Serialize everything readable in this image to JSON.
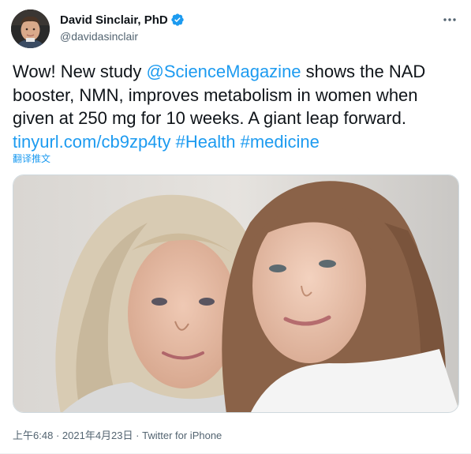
{
  "author": {
    "display_name": "David Sinclair, PhD",
    "handle": "@davidasinclair",
    "verified_icon": "verified-badge-icon",
    "verified_color": "#1d9bf0"
  },
  "tweet": {
    "lines": [
      [
        {
          "text": "Wow! New study ",
          "type": "text"
        },
        {
          "text": "@ScienceMagazine",
          "type": "mention"
        },
        {
          "text": " shows the NAD",
          "type": "text"
        }
      ],
      [
        {
          "text": "booster, NMN, improves metabolism in women when",
          "type": "text"
        }
      ],
      [
        {
          "text": "given at 250 mg for 10 weeks. A giant leap forward.",
          "type": "text"
        }
      ],
      [
        {
          "text": "tinyurl.com/cb9zp4ty",
          "type": "url"
        },
        {
          "text": " ",
          "type": "text"
        },
        {
          "text": "#Health",
          "type": "hashtag"
        },
        {
          "text": " ",
          "type": "text"
        },
        {
          "text": "#medicine",
          "type": "hashtag"
        }
      ]
    ],
    "translate_label": "翻译推文",
    "link_color": "#1d9bf0"
  },
  "media": {
    "icon": "photo"
  },
  "meta": {
    "time": "上午6:48",
    "separator": "·",
    "date": "2021年4月23日",
    "source": "Twitter for iPhone"
  },
  "more_icon": "more-horizontal-icon"
}
